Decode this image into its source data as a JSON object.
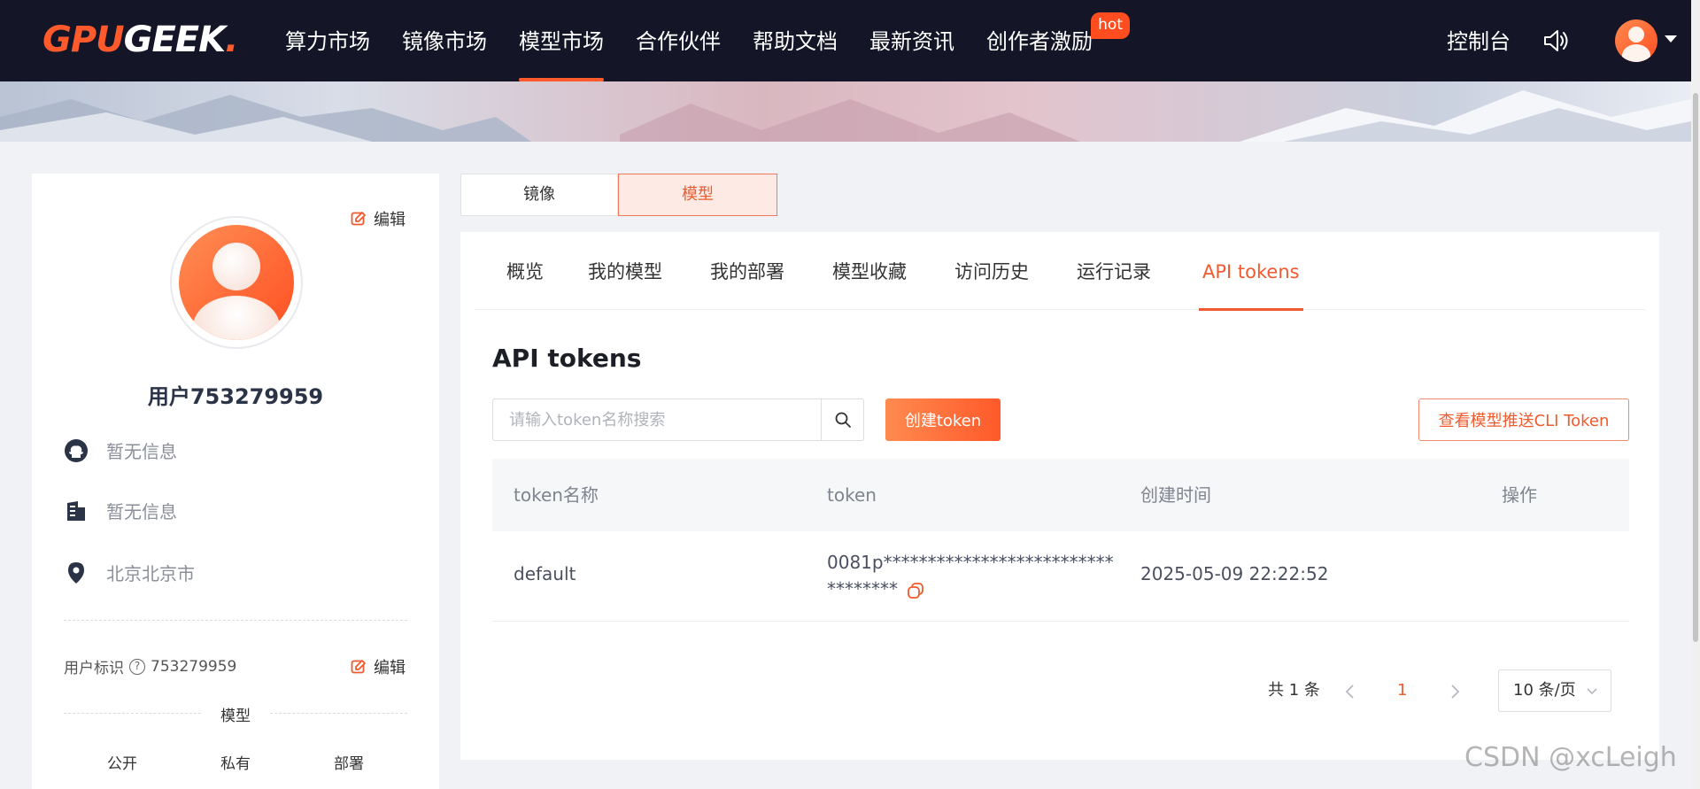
{
  "brand": {
    "part1": "GPU",
    "part2": "GEEK",
    "dot": "."
  },
  "nav": {
    "items": [
      {
        "label": "算力市场"
      },
      {
        "label": "镜像市场"
      },
      {
        "label": "模型市场"
      },
      {
        "label": "合作伙伴"
      },
      {
        "label": "帮助文档"
      },
      {
        "label": "最新资讯"
      },
      {
        "label": "创作者激励"
      }
    ],
    "active_index": 2,
    "hot_badge": "hot",
    "console": "控制台"
  },
  "profile": {
    "edit_label": "编辑",
    "username": "用户753279959",
    "github": "暂无信息",
    "company": "暂无信息",
    "location": "北京北京市",
    "uid_label": "用户标识",
    "uid_value": "753279959",
    "section_title": "模型",
    "stats": [
      "公开",
      "私有",
      "部署"
    ]
  },
  "segments": {
    "mirror": "镜像",
    "model": "模型",
    "active": "model"
  },
  "tabs": [
    {
      "label": "概览"
    },
    {
      "label": "我的模型"
    },
    {
      "label": "我的部署"
    },
    {
      "label": "模型收藏"
    },
    {
      "label": "访问历史"
    },
    {
      "label": "运行记录"
    },
    {
      "label": "API tokens"
    }
  ],
  "active_tab": "API tokens",
  "main": {
    "title": "API tokens",
    "search_placeholder": "请输入token名称搜索",
    "create_button": "创建token",
    "cli_button": "查看模型推送CLI Token",
    "table": {
      "columns": [
        "token名称",
        "token",
        "创建时间",
        "操作"
      ],
      "rows": [
        {
          "name": "default",
          "token": "0081p**********************************",
          "created": "2025-05-09 22:22:52"
        }
      ]
    },
    "pagination": {
      "total": "共 1 条",
      "current_page": "1",
      "page_size": "10 条/页"
    }
  },
  "colors": {
    "accent": "#ef5a2e",
    "nav_bg": "#141627",
    "page_bg": "#f1f2f5"
  },
  "watermark": "CSDN @xcLeigh"
}
